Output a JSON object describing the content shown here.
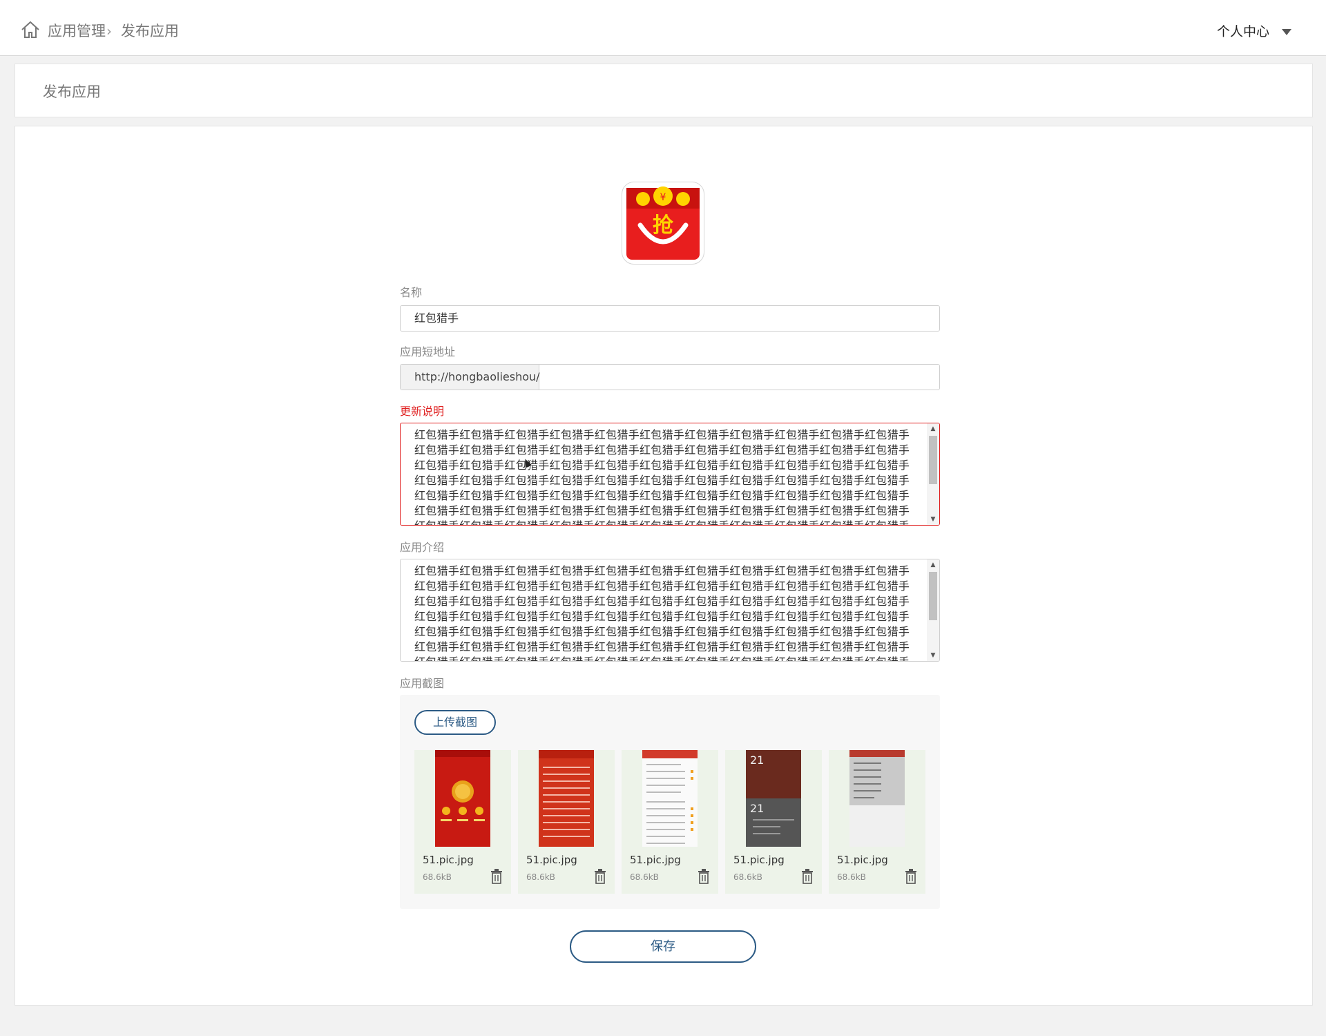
{
  "header": {
    "breadcrumb": [
      "应用管理",
      "发布应用"
    ],
    "user_menu": "个人中心"
  },
  "page_title": "发布应用",
  "app_icon_char": "抢",
  "form": {
    "name_label": "名称",
    "name_value": "红包猎手",
    "short_url_label": "应用短地址",
    "short_url_prefix": "http://hongbaolieshou/",
    "short_url_value": "",
    "update_label": "更新说明",
    "update_text": "红包猎手红包猎手红包猎手红包猎手红包猎手红包猎手红包猎手红包猎手红包猎手红包猎手红包猎手红包猎手红包猎手红包猎手红包猎手红包猎手红包猎手红包猎手红包猎手红包猎手红包猎手红包猎手红包猎手红包猎手红包猎手红包猎手红包猎手红包猎手红包猎手红包猎手红包猎手红包猎手红包猎手红包猎手红包猎手红包猎手红包猎手红包猎手红包猎手红包猎手红包猎手红包猎手红包猎手红包猎手红包猎手红包猎手红包猎手红包猎手红包猎手红包猎手红包猎手红包猎手红包猎手红包猎手红包猎手红包猎手红包猎手红包猎手红包猎手红包猎手红包猎手红包猎手红包猎手红包猎手红包猎手红包猎手红包猎手红包猎手红包猎手红包猎手红包猎手红包猎手红包猎手红包猎手红包猎手红包猎手红包猎手红包猎手红包猎手红包猎手红包猎手红包猎手红包猎手红包猎手红包猎手红包猎手红包猎手红包猎手红包猎手红包猎手红包猎手红包猎手红包猎手红包猎手红包猎手红包猎手红包猎手红包猎手红包猎手红包猎手红包猎手红包猎手红包猎手红包猎手红包猎手红包猎手",
    "intro_label": "应用介绍",
    "intro_text": "红包猎手红包猎手红包猎手红包猎手红包猎手红包猎手红包猎手红包猎手红包猎手红包猎手红包猎手红包猎手红包猎手红包猎手红包猎手红包猎手红包猎手红包猎手红包猎手红包猎手红包猎手红包猎手红包猎手红包猎手红包猎手红包猎手红包猎手红包猎手红包猎手红包猎手红包猎手红包猎手红包猎手红包猎手红包猎手红包猎手红包猎手红包猎手红包猎手红包猎手红包猎手红包猎手红包猎手红包猎手红包猎手红包猎手红包猎手红包猎手红包猎手红包猎手红包猎手红包猎手红包猎手红包猎手红包猎手红包猎手红包猎手红包猎手红包猎手红包猎手红包猎手红包猎手红包猎手红包猎手红包猎手红包猎手红包猎手红包猎手红包猎手红包猎手红包猎手红包猎手红包猎手红包猎手红包猎手红包猎手红包猎手红包猎手红包猎手红包猎手红包猎手红包猎手红包猎手红包猎手红包猎手红包猎手红包猎手红包猎手红包猎手红包猎手红包猎手红包猎手红包猎手红包猎手红包猎手红包猎手红包猎手红包猎手红包猎手红包猎手红包猎手",
    "screenshots_label": "应用截图",
    "upload_button": "上传截图",
    "screenshots": [
      {
        "name": "51.pic.jpg",
        "size": "68.6kB",
        "theme": "red-home"
      },
      {
        "name": "51.pic.jpg",
        "size": "68.6kB",
        "theme": "red-list"
      },
      {
        "name": "51.pic.jpg",
        "size": "68.6kB",
        "theme": "white-settings"
      },
      {
        "name": "51.pic.jpg",
        "size": "68.6kB",
        "theme": "dark-clock"
      },
      {
        "name": "51.pic.jpg",
        "size": "68.6kB",
        "theme": "gray-menu"
      }
    ],
    "save_button": "保存"
  },
  "colors": {
    "accent": "#2b5a84",
    "error": "#e02020",
    "icon_red": "#e81e1e",
    "icon_gold": "#ffd400"
  }
}
